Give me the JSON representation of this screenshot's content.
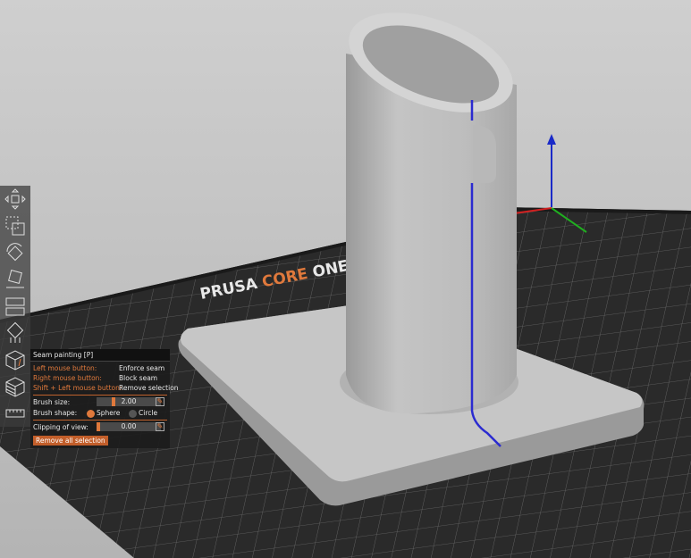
{
  "bed_logo": "PRUSA CORE ONE",
  "toolbar": {
    "items": [
      {
        "name": "move-icon"
      },
      {
        "name": "scale-icon"
      },
      {
        "name": "rotate-icon"
      },
      {
        "name": "place-on-face-icon"
      },
      {
        "name": "cut-icon"
      },
      {
        "name": "support-painting-icon"
      },
      {
        "name": "seam-painting-icon"
      },
      {
        "name": "mmu-painting-icon"
      },
      {
        "name": "measure-icon"
      }
    ]
  },
  "seam_panel": {
    "title": "Seam painting [P]",
    "hints": [
      {
        "key": "Left mouse button:",
        "action": "Enforce seam"
      },
      {
        "key": "Right mouse button:",
        "action": "Block seam"
      },
      {
        "key": "Shift + Left mouse button:",
        "action": "Remove selection"
      }
    ],
    "brush_size_label": "Brush size:",
    "brush_size_value": "2.00",
    "brush_size_fraction": 0.25,
    "brush_shape_label": "Brush shape:",
    "shape_sphere": "Sphere",
    "shape_circle": "Circle",
    "selected_shape": "Sphere",
    "clipping_label": "Clipping of view:",
    "clipping_value": "0.00",
    "clipping_fraction": 0.0,
    "remove_all_label": "Remove all selection"
  },
  "colors": {
    "accent": "#e0793c",
    "seam": "#2b2bd0"
  }
}
